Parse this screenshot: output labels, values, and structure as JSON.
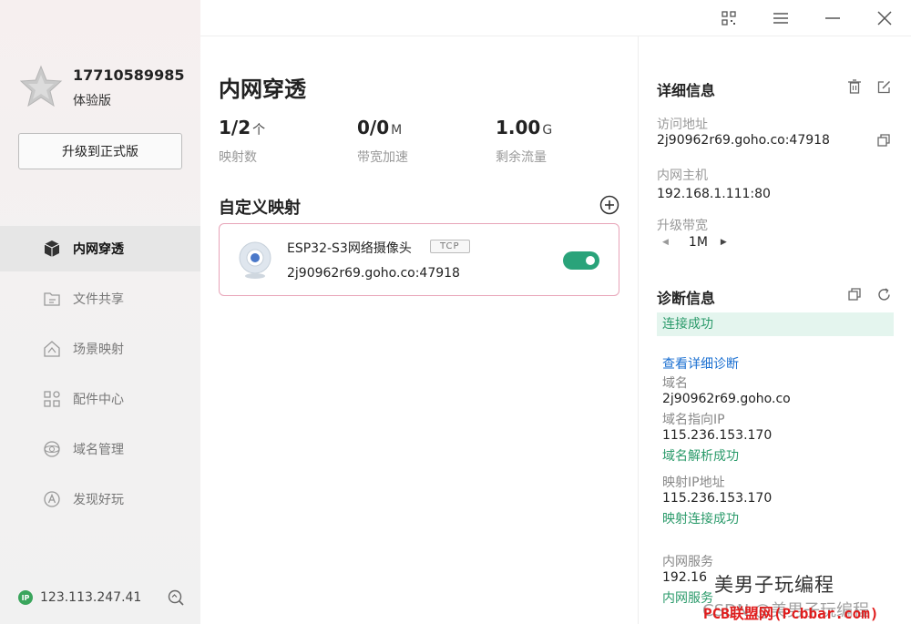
{
  "user": {
    "phone": "17710589985",
    "plan": "体验版",
    "upgrade_label": "升级到正式版"
  },
  "nav": [
    {
      "label": "内网穿透",
      "icon": "cube-icon",
      "active": true
    },
    {
      "label": "文件共享",
      "icon": "folder-share-icon",
      "active": false
    },
    {
      "label": "场景映射",
      "icon": "scene-map-icon",
      "active": false
    },
    {
      "label": "配件中心",
      "icon": "grid-apps-icon",
      "active": false
    },
    {
      "label": "域名管理",
      "icon": "domain-icon",
      "active": false
    },
    {
      "label": "发现好玩",
      "icon": "discover-icon",
      "active": false
    }
  ],
  "footer": {
    "ip_badge": "IP",
    "ip": "123.113.247.41"
  },
  "main": {
    "title": "内网穿透",
    "stats": [
      {
        "value": "1/2",
        "unit": "个",
        "label": "映射数"
      },
      {
        "value": "0/0",
        "unit": "M",
        "label": "带宽加速"
      },
      {
        "value": "1.00",
        "unit": "G",
        "label": "剩余流量"
      }
    ],
    "section_title": "自定义映射",
    "mapping": {
      "name": "ESP32-S3网络摄像头",
      "protocol": "TCP",
      "address": "2j90962r69.goho.co:47918",
      "enabled": true
    }
  },
  "details": {
    "title": "详细信息",
    "access_label": "访问地址",
    "access_value": "2j90962r69.goho.co:47918",
    "host_label": "内网主机",
    "host_value": "192.168.1.111:80",
    "bandwidth_label": "升级带宽",
    "bandwidth_value": "1M"
  },
  "diagnosis": {
    "title": "诊断信息",
    "status": "连接成功",
    "link": "查看详细诊断",
    "domain_label": "域名",
    "domain_value": "2j90962r69.goho.co",
    "domain_ip_label": "域名指向IP",
    "domain_ip_value": "115.236.153.170",
    "domain_ok": "域名解析成功",
    "map_ip_label": "映射IP地址",
    "map_ip_value": "115.236.153.170",
    "map_ok": "映射连接成功",
    "inner_label": "内网服务",
    "inner_value": "192.16",
    "inner_ok": "内网服务"
  },
  "watermark": {
    "line1": "美男子玩编程",
    "line2": "CSDN @美男子玩编程",
    "line3": "PCB联盟网(Pcbbar.com)"
  },
  "colors": {
    "accent_green": "#2aa37a",
    "link_blue": "#1a6fd1",
    "card_border": "#e8a4b8",
    "status_bg": "#e4f5ee"
  }
}
